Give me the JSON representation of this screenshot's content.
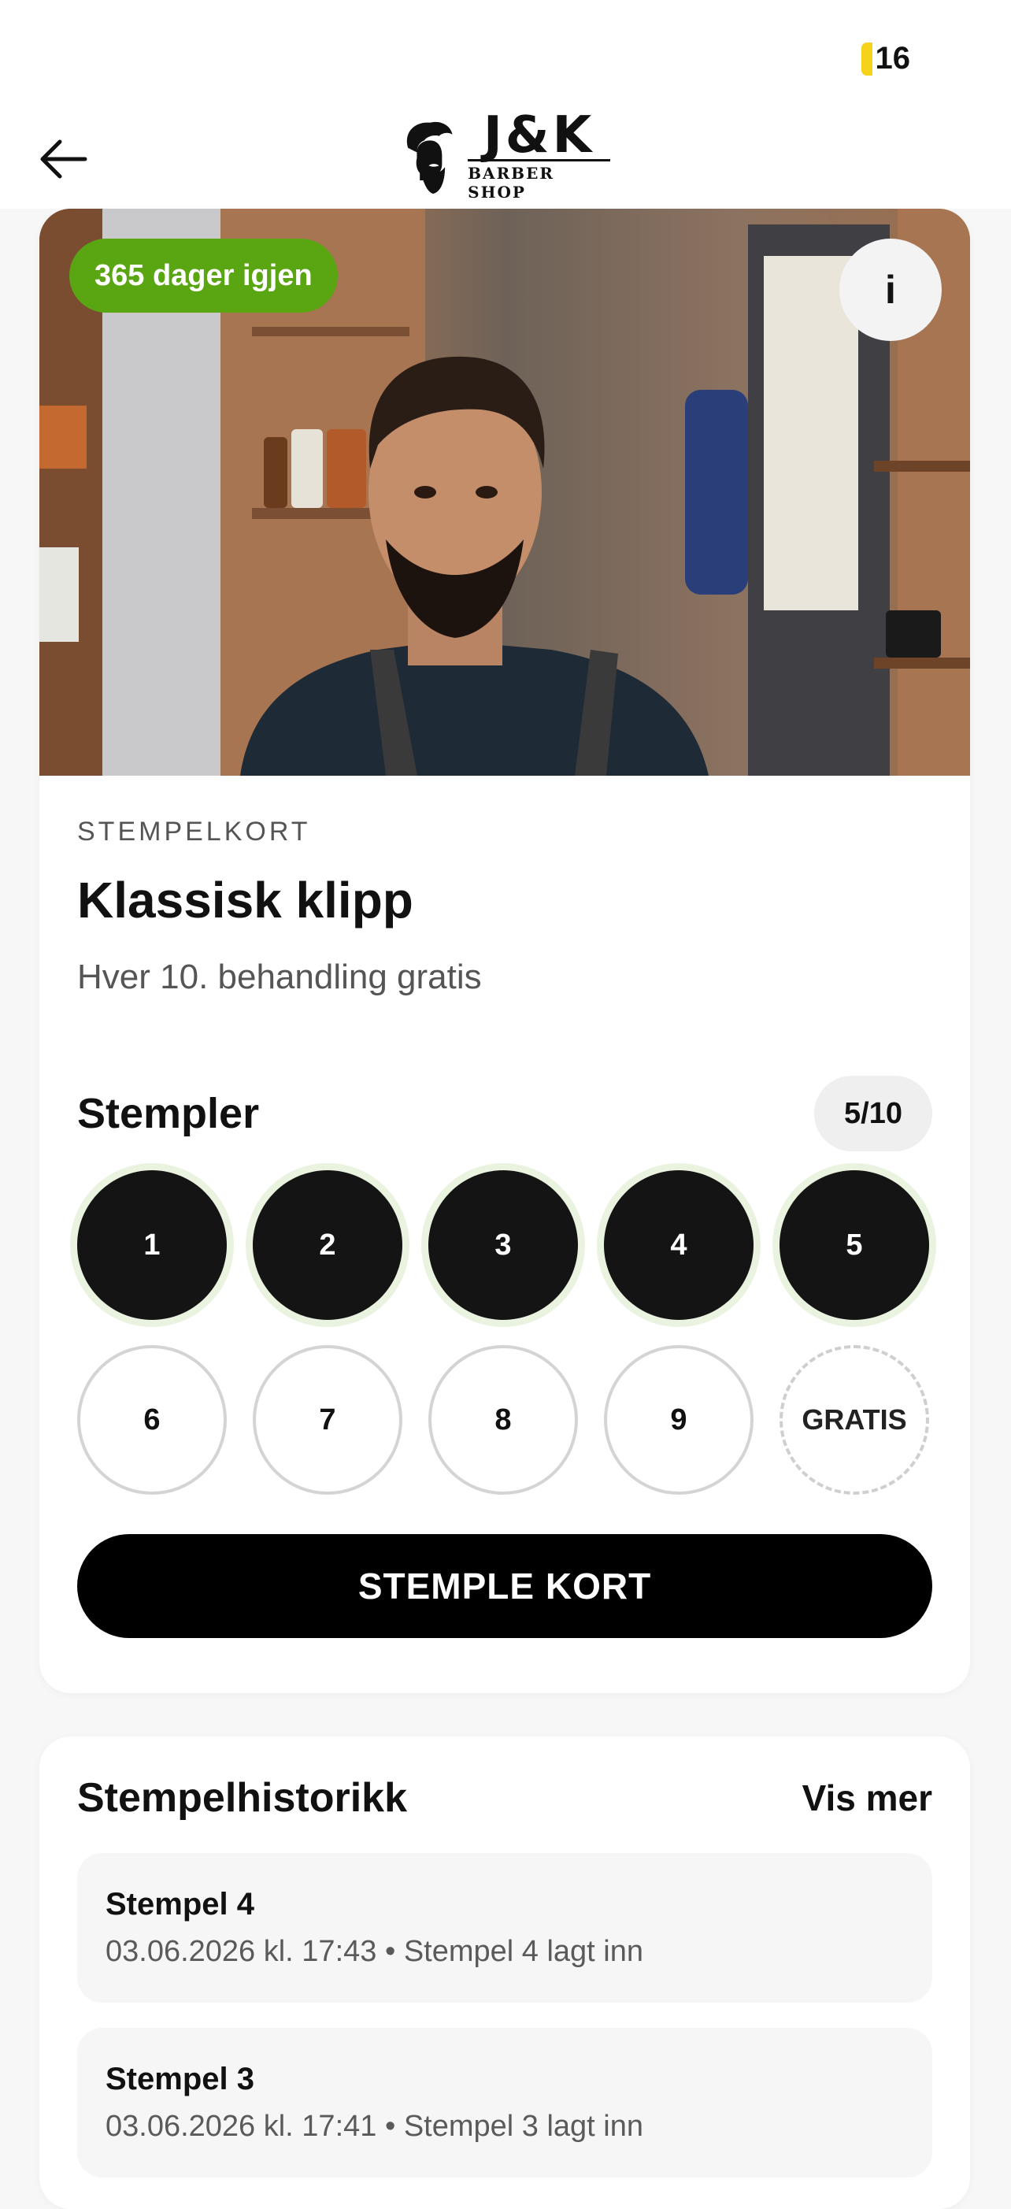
{
  "status_bar": {
    "battery_level": "16",
    "battery_color": "#f6d21a"
  },
  "nav": {
    "back_icon": "arrow-left-icon",
    "logo_title": "J&K",
    "logo_subtitle": "BARBER SHOP"
  },
  "card": {
    "days_left": "365 dager igjen",
    "info_label": "i",
    "kicker": "STEMPELKORT",
    "title": "Klassisk klipp",
    "subtitle": "Hver 10. behandling gratis",
    "stamps_label": "Stempler",
    "stamps_count": "5/10",
    "stamps": [
      {
        "label": "1",
        "state": "filled"
      },
      {
        "label": "2",
        "state": "filled"
      },
      {
        "label": "3",
        "state": "filled"
      },
      {
        "label": "4",
        "state": "filled"
      },
      {
        "label": "5",
        "state": "filled"
      },
      {
        "label": "6",
        "state": "empty"
      },
      {
        "label": "7",
        "state": "empty"
      },
      {
        "label": "8",
        "state": "empty"
      },
      {
        "label": "9",
        "state": "empty"
      },
      {
        "label": "GRATIS",
        "state": "free"
      }
    ],
    "button_label": "STEMPLE KORT",
    "accent_color": "#5aa512"
  },
  "history": {
    "title": "Stempelhistorikk",
    "more_label": "Vis mer",
    "items": [
      {
        "title": "Stempel 4",
        "meta": "03.06.2026 kl. 17:43 • Stempel 4 lagt inn"
      },
      {
        "title": "Stempel 3",
        "meta": "03.06.2026 kl. 17:41 • Stempel 3 lagt inn"
      }
    ]
  }
}
